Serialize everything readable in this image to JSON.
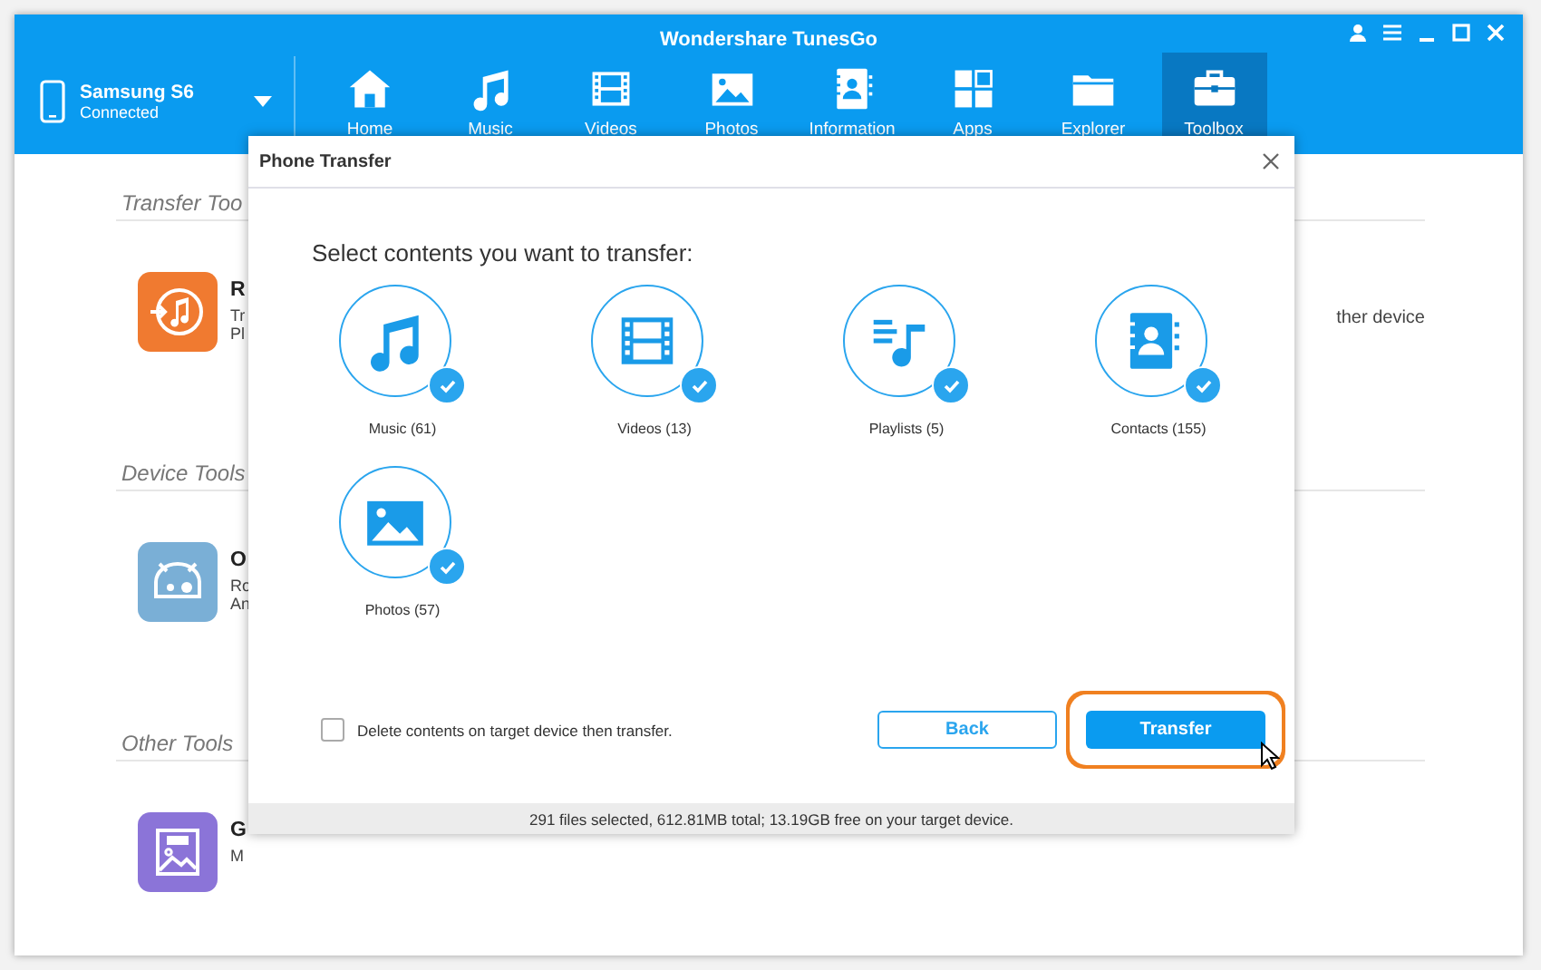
{
  "window": {
    "title": "Wondershare TunesGo"
  },
  "device": {
    "name": "Samsung S6",
    "status": "Connected"
  },
  "nav": [
    {
      "label": "Home",
      "kind": "home",
      "selected": false
    },
    {
      "label": "Music",
      "kind": "music",
      "selected": false
    },
    {
      "label": "Videos",
      "kind": "videos",
      "selected": false
    },
    {
      "label": "Photos",
      "kind": "photos",
      "selected": false
    },
    {
      "label": "Information",
      "kind": "contacts",
      "selected": false
    },
    {
      "label": "Apps",
      "kind": "apps",
      "selected": false
    },
    {
      "label": "Explorer",
      "kind": "folder",
      "selected": false
    },
    {
      "label": "Toolbox",
      "kind": "toolbox",
      "selected": true
    }
  ],
  "sections": [
    {
      "title": "Transfer Too",
      "tools": [
        {
          "kind": "itunes",
          "title": "R",
          "description": [
            "Tr",
            "Pl"
          ],
          "trailing": "ther device"
        }
      ]
    },
    {
      "title": "Device Tools",
      "tools": [
        {
          "kind": "android",
          "title": "O",
          "description": [
            "Ro",
            "An"
          ]
        }
      ]
    },
    {
      "title": "Other Tools",
      "tools": [
        {
          "kind": "gif",
          "title": "G",
          "description": [
            "M"
          ]
        }
      ]
    }
  ],
  "dialog": {
    "title": "Phone Transfer",
    "prompt": "Select contents you want to transfer:",
    "items": [
      {
        "kind": "music",
        "label": "Music (61)",
        "checked": true
      },
      {
        "kind": "videos",
        "label": "Videos (13)",
        "checked": true
      },
      {
        "kind": "playlists",
        "label": "Playlists (5)",
        "checked": true
      },
      {
        "kind": "contacts",
        "label": "Contacts (155)",
        "checked": true
      },
      {
        "kind": "photos",
        "label": "Photos (57)",
        "checked": true
      }
    ],
    "delete_option": {
      "label": "Delete contents on target device then transfer.",
      "checked": false
    },
    "buttons": [
      {
        "kind": "secondary",
        "label": "Back",
        "highlighted": false
      },
      {
        "kind": "primary",
        "label": "Transfer",
        "highlighted": true
      }
    ],
    "status": "291 files selected, 612.81MB total; 13.19GB free on your target device."
  }
}
